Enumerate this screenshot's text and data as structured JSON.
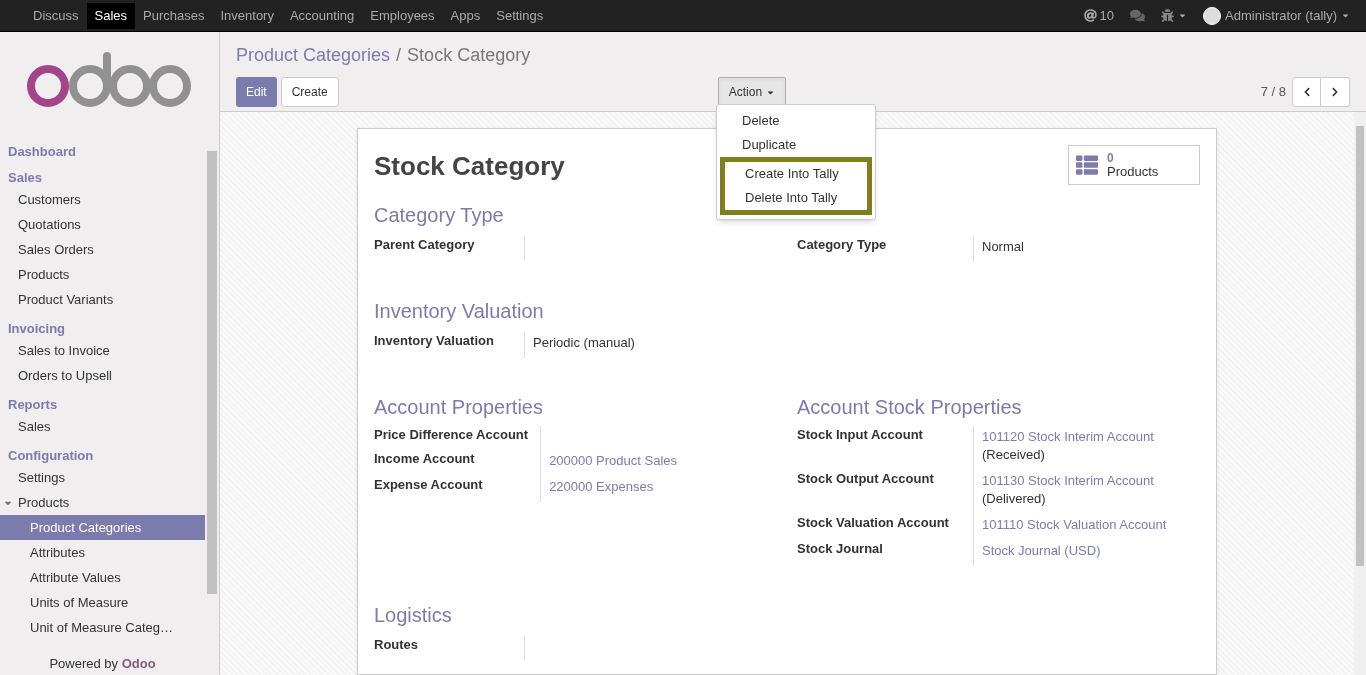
{
  "top_menu": [
    {
      "label": "Discuss",
      "selected": false
    },
    {
      "label": "Sales",
      "selected": true
    },
    {
      "label": "Purchases",
      "selected": false
    },
    {
      "label": "Inventory",
      "selected": false
    },
    {
      "label": "Accounting",
      "selected": false
    },
    {
      "label": "Employees",
      "selected": false
    },
    {
      "label": "Apps",
      "selected": false
    },
    {
      "label": "Settings",
      "selected": false
    }
  ],
  "systray": {
    "mentions": "10",
    "user": "Administrator (tally)"
  },
  "sidebar": {
    "items": [
      {
        "kind": "header",
        "label": "Dashboard"
      },
      {
        "kind": "header",
        "label": "Sales"
      },
      {
        "kind": "item",
        "label": "Customers",
        "selected": false
      },
      {
        "kind": "item",
        "label": "Quotations",
        "selected": false
      },
      {
        "kind": "item",
        "label": "Sales Orders",
        "selected": false
      },
      {
        "kind": "item",
        "label": "Products",
        "selected": false
      },
      {
        "kind": "item",
        "label": "Product Variants",
        "selected": false
      },
      {
        "kind": "header",
        "label": "Invoicing"
      },
      {
        "kind": "item",
        "label": "Sales to Invoice",
        "selected": false
      },
      {
        "kind": "item",
        "label": "Orders to Upsell",
        "selected": false
      },
      {
        "kind": "header",
        "label": "Reports"
      },
      {
        "kind": "item",
        "label": "Sales",
        "selected": false
      },
      {
        "kind": "header",
        "label": "Configuration"
      },
      {
        "kind": "item",
        "label": "Settings",
        "selected": false
      },
      {
        "kind": "item",
        "label": "Products",
        "selected": false,
        "expanded": true,
        "children": [
          {
            "label": "Product Categories",
            "selected": true
          },
          {
            "label": "Attributes",
            "selected": false
          },
          {
            "label": "Attribute Values",
            "selected": false
          },
          {
            "label": "Units of Measure",
            "selected": false
          },
          {
            "label": "Unit of Measure Categ…",
            "selected": false
          }
        ]
      }
    ],
    "footer": {
      "text": "Powered by",
      "brand": "Odoo"
    }
  },
  "breadcrumb": {
    "parent": "Product Categories",
    "separator": "/",
    "current": "Stock Category"
  },
  "buttons": {
    "edit": "Edit",
    "create": "Create",
    "action": "Action"
  },
  "action_menu": [
    {
      "label": "Delete",
      "highlighted": false
    },
    {
      "label": "Duplicate",
      "highlighted": false
    },
    {
      "label": "Create Into Tally",
      "highlighted": true
    },
    {
      "label": "Delete Into Tally",
      "highlighted": true
    }
  ],
  "pager": {
    "value": "7 / 8"
  },
  "record": {
    "title": "Stock Category",
    "stat": {
      "count": "0",
      "label": "Products"
    },
    "rows": [
      {
        "title": "Category Type",
        "columns": [
          {
            "fields": [
              {
                "label": "Parent Category"
              }
            ]
          },
          {
            "fields": [
              {
                "label": "Category Type",
                "value": "Normal",
                "kind": "text"
              }
            ]
          }
        ]
      },
      {
        "title": "Inventory Valuation",
        "columns": [
          {
            "fields": [
              {
                "label": "Inventory Valuation",
                "value": "Periodic (manual)",
                "kind": "text"
              }
            ]
          }
        ]
      },
      {
        "columns": [
          {
            "title": "Account Properties",
            "fields": [
              {
                "label": "Price Difference Account"
              },
              {
                "label": "Income Account",
                "value": "200000 Product Sales",
                "kind": "link"
              },
              {
                "label": "Expense Account",
                "value": "220000 Expenses",
                "kind": "link"
              }
            ]
          },
          {
            "title": "Account Stock Properties",
            "fields": [
              {
                "label": "Stock Input Account",
                "value": "101120 Stock Interim Account",
                "kind": "link",
                "note": "(Received)"
              },
              {
                "label": "Stock Output Account",
                "value": "101130 Stock Interim Account",
                "kind": "link",
                "note": "(Delivered)"
              },
              {
                "label": "Stock Valuation Account",
                "value": "101110 Stock Valuation Account",
                "kind": "link"
              },
              {
                "label": "Stock Journal",
                "value": "Stock Journal (USD)",
                "kind": "link"
              }
            ]
          }
        ]
      },
      {
        "title": "Logistics",
        "columns": [
          {
            "fields": [
              {
                "label": "Routes"
              }
            ]
          }
        ]
      }
    ]
  }
}
